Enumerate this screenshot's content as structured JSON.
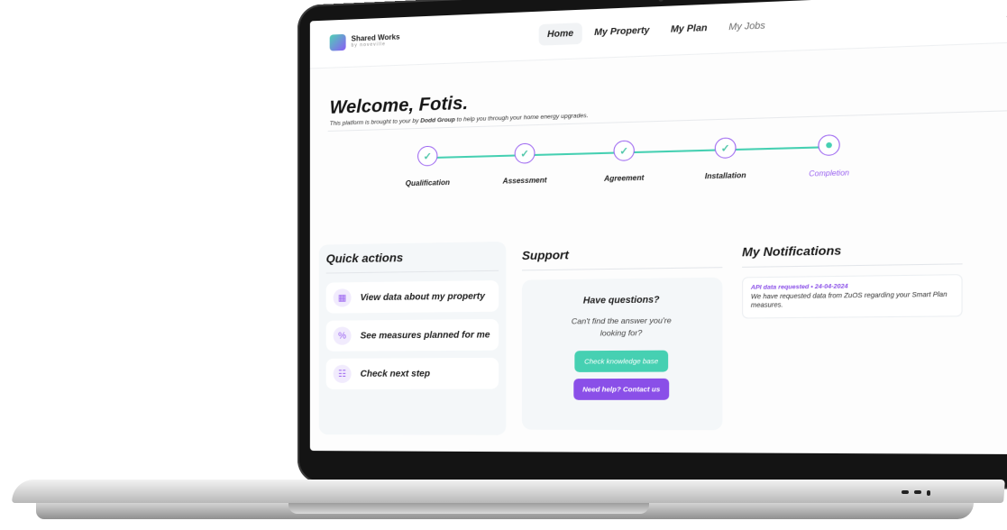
{
  "app": {
    "logo_title": "Shared Works",
    "logo_subtitle": "by noveville"
  },
  "nav": {
    "tabs": [
      {
        "label": "Home",
        "active": true
      },
      {
        "label": "My Property",
        "active": false
      },
      {
        "label": "My Plan",
        "active": false
      },
      {
        "label": "My Jobs",
        "active": false
      }
    ]
  },
  "welcome": {
    "title": "Welcome, Fotis.",
    "subtitle_before": "This platform is brought to your by ",
    "subtitle_company": "Dodd Group",
    "subtitle_after": " to help you through your home energy upgrades."
  },
  "stepper": {
    "steps": [
      {
        "label": "Qualification",
        "status": "done"
      },
      {
        "label": "Assessment",
        "status": "done"
      },
      {
        "label": "Agreement",
        "status": "done"
      },
      {
        "label": "Installation",
        "status": "done"
      },
      {
        "label": "Completion",
        "status": "current"
      }
    ]
  },
  "quick_actions": {
    "title": "Quick actions",
    "items": [
      {
        "label": "View data about my property",
        "icon": "building-icon"
      },
      {
        "label": "See measures planned for me",
        "icon": "percent-icon"
      },
      {
        "label": "Check next step",
        "icon": "sitemap-icon"
      }
    ]
  },
  "support": {
    "title": "Support",
    "card_title": "Have questions?",
    "card_body": "Can't find the answer you're looking for?",
    "kb_button": "Check knowledge base",
    "contact_button": "Need help? Contact us"
  },
  "notifications": {
    "title": "My Notifications",
    "items": [
      {
        "heading": "API data requested • 24-04-2024",
        "body": "We have requested data from ZuOS regarding your Smart Plan measures."
      }
    ]
  },
  "colors": {
    "accent_purple": "#8a4fe8",
    "accent_teal": "#46d0b2"
  }
}
